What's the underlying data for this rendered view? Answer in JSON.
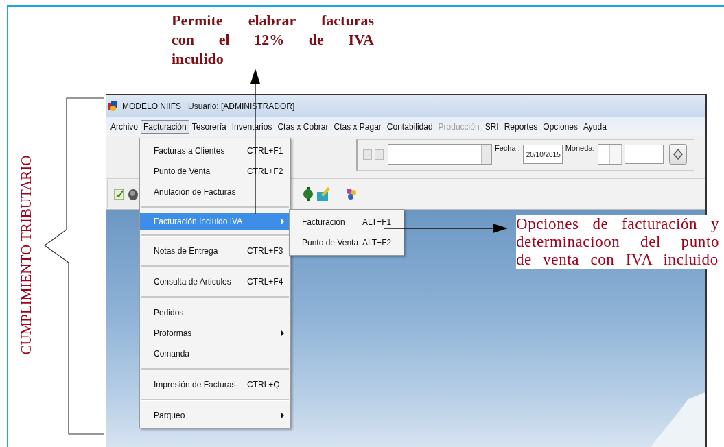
{
  "annotations": {
    "top_note": "Permite elabrar facturas con el 12% de IVA inculido",
    "side_note": "Opciones de facturación y determinacioon del punto de venta con IVA incluido",
    "side_label": "CUMPLIMIENTO TRIBUTARIO"
  },
  "window": {
    "app": "MODELO NIIFS",
    "user": "Usuario: [ADMINISTRADOR]"
  },
  "menubar": [
    {
      "label": "Archivo",
      "selected": false,
      "disabled": false
    },
    {
      "label": "Facturación",
      "selected": true,
      "disabled": false
    },
    {
      "label": "Tesorería",
      "selected": false,
      "disabled": false
    },
    {
      "label": "Inventarios",
      "selected": false,
      "disabled": false
    },
    {
      "label": "Ctas x Cobrar",
      "selected": false,
      "disabled": false
    },
    {
      "label": "Ctas x Pagar",
      "selected": false,
      "disabled": false
    },
    {
      "label": "Contabilidad",
      "selected": false,
      "disabled": false
    },
    {
      "label": "Producción",
      "selected": false,
      "disabled": true
    },
    {
      "label": "SRI",
      "selected": false,
      "disabled": false
    },
    {
      "label": "Reportes",
      "selected": false,
      "disabled": false
    },
    {
      "label": "Opciones",
      "selected": false,
      "disabled": false
    },
    {
      "label": "Ayuda",
      "selected": false,
      "disabled": false
    }
  ],
  "toolbar": {
    "date_label": "Fecha :",
    "date_value": "20/10/2015",
    "currency_label": "Moneda:"
  },
  "menu": [
    {
      "kind": "item",
      "label": "Facturas a Clientes",
      "shortcut": "CTRL+F1",
      "submenu": false,
      "selected": false
    },
    {
      "kind": "item",
      "label": "Punto de Venta",
      "shortcut": "CTRL+F2",
      "submenu": false,
      "selected": false
    },
    {
      "kind": "item",
      "label": "Anulación de Facturas",
      "submenu": false,
      "selected": false
    },
    {
      "kind": "separator"
    },
    {
      "kind": "item",
      "label": "Facturación Incluido IVA",
      "submenu": true,
      "selected": true
    },
    {
      "kind": "separator"
    },
    {
      "kind": "item",
      "label": "Notas de Entrega",
      "shortcut": "CTRL+F3",
      "submenu": false,
      "selected": false
    },
    {
      "kind": "separator"
    },
    {
      "kind": "item",
      "label": "Consulta de Articulos",
      "shortcut": "CTRL+F4",
      "submenu": false,
      "selected": false
    },
    {
      "kind": "separator"
    },
    {
      "kind": "item",
      "label": "Pedidos",
      "submenu": false,
      "selected": false
    },
    {
      "kind": "item",
      "label": "Proformas",
      "submenu": true,
      "selected": false
    },
    {
      "kind": "item",
      "label": "Comanda",
      "submenu": false,
      "selected": false
    },
    {
      "kind": "separator"
    },
    {
      "kind": "item",
      "label": "Impresión de Facturas",
      "shortcut": "CTRL+Q",
      "submenu": false,
      "selected": false
    },
    {
      "kind": "separator"
    },
    {
      "kind": "item",
      "label": "Parqueo",
      "submenu": true,
      "selected": false
    }
  ],
  "submenu": [
    {
      "label": "Facturación",
      "shortcut": "ALT+F1"
    },
    {
      "label": "Punto de Venta",
      "shortcut": "ALT+F2"
    }
  ]
}
